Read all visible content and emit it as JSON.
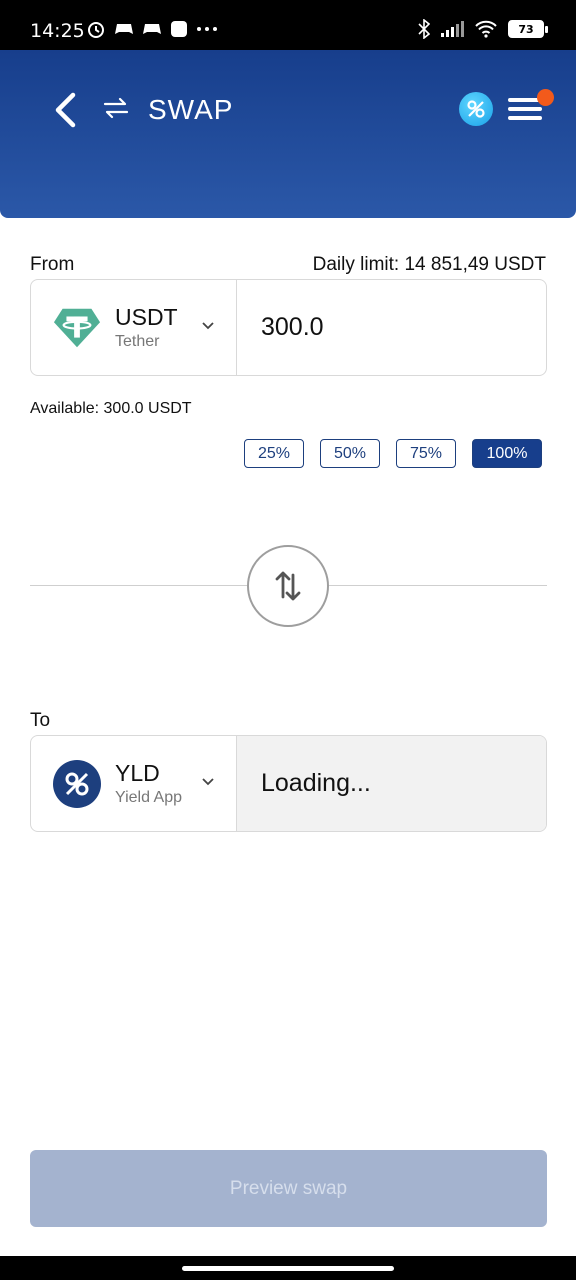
{
  "status": {
    "time": "14:25",
    "battery": "73"
  },
  "header": {
    "title": "SWAP"
  },
  "from": {
    "label": "From",
    "daily_limit": "Daily limit: 14 851,49 USDT",
    "currency_code": "USDT",
    "currency_name": "Tether",
    "amount": "300.0",
    "available": "Available: 300.0 USDT"
  },
  "percentages": [
    "25%",
    "50%",
    "75%",
    "100%"
  ],
  "to": {
    "label": "To",
    "currency_code": "YLD",
    "currency_name": "Yield App",
    "amount": "Loading..."
  },
  "preview_button": "Preview swap",
  "colors": {
    "header_top": "#173e8c",
    "header_bottom": "#2b58a8",
    "tether_green": "#50af95",
    "yld_blue": "#1d3f7e",
    "notification": "#f25a1b",
    "button_disabled": "#a4b3cf"
  }
}
